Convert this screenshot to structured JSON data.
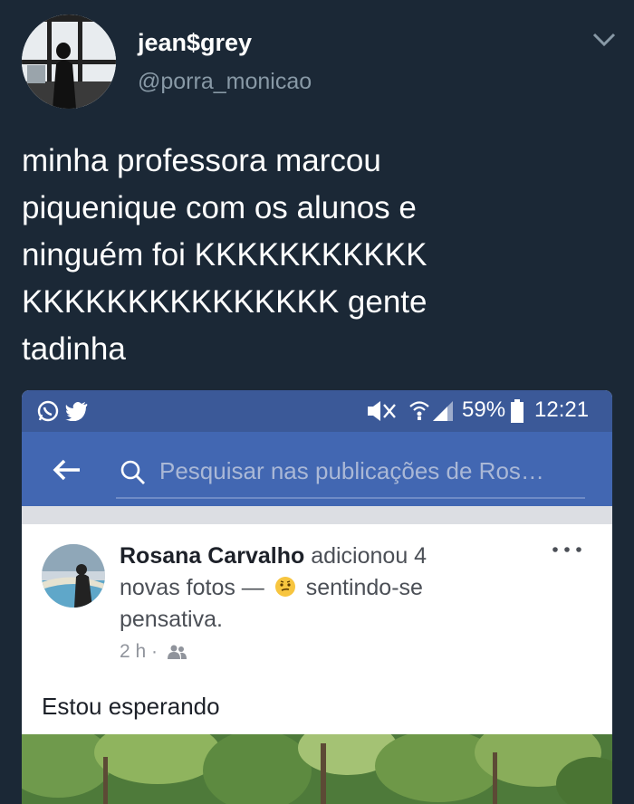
{
  "tweet": {
    "display_name": "jean$grey",
    "handle": "@porra_monicao",
    "text_lines": [
      "minha professora marcou",
      "piquenique com os alunos e",
      "ninguém foi KKKKKKKKKKK",
      "KKKKKKKKKKKKKKK gente",
      "tadinha"
    ]
  },
  "phone_status": {
    "battery": "59%",
    "time": "12:21",
    "icons": [
      "whatsapp-icon",
      "twitter-icon",
      "mute-icon",
      "wifi-icon",
      "signal-icon",
      "battery-icon"
    ]
  },
  "facebook": {
    "search_placeholder": "Pesquisar nas publicações de Ros…",
    "post": {
      "author": "Rosana Carvalho",
      "action_line1": " adicionou 4",
      "action_line2a": "novas fotos — ",
      "action_line2b": " sentindo-se",
      "action_line3": "pensativa.",
      "time": "2 h",
      "dot": "·",
      "body": "Estou esperando"
    },
    "colors": {
      "status_bar": "#3b5998",
      "nav_bar": "#4267b2"
    }
  },
  "colors": {
    "background": "#1b2836",
    "handle": "#8899a6"
  }
}
